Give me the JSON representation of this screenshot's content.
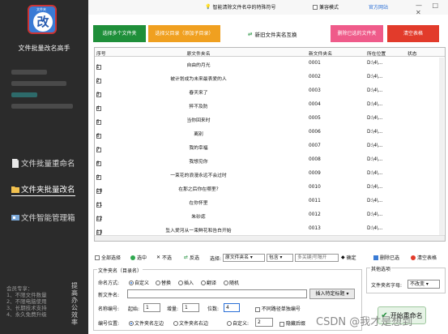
{
  "sidebar": {
    "logo_tag": "文件夹",
    "logo_char": "改",
    "app_title": "文件批量改名高手",
    "nav": [
      {
        "label": "文件批量重命名",
        "icon": "file-icon"
      },
      {
        "label": "文件夹批量改名",
        "icon": "folder-icon",
        "active": true
      },
      {
        "label": "文件智能管理箱",
        "icon": "grid-icon"
      }
    ],
    "promo_lines": [
      "会员专享：",
      "1、不限文件数量",
      "2、不限电脑使用",
      "3、长期技术支持",
      "4、永久免费升级"
    ],
    "promo_side": "提高办公效率"
  },
  "topbar": {
    "option1": "智能清除文件名中的特殊符号",
    "option2": "兼容模式",
    "official_site": "官方网站",
    "window_controls": "— □ ✕"
  },
  "toolbar": {
    "btn_add_files": "选择多个文件夹",
    "btn_add_dir": "选择父目录（添加子目录）",
    "link_swap": "新旧文件夹名互换",
    "btn_delete_selected": "删除已选的文件夹",
    "btn_clear": "清空表格"
  },
  "table": {
    "headers": {
      "no": "序号",
      "name": "原文件夹名",
      "new": "新文件夹名",
      "loc": "所在位置",
      "state": "状态"
    },
    "rows": [
      {
        "no": "1",
        "name": "自由的月光",
        "new": "0001",
        "loc": "D:\\4\\..."
      },
      {
        "no": "2",
        "name": "被计划成为未来最表爱的人",
        "new": "0002",
        "loc": "D:\\4\\..."
      },
      {
        "no": "3",
        "name": "春天来了",
        "new": "0003",
        "loc": "D:\\4\\..."
      },
      {
        "no": "4",
        "name": "猝不及防",
        "new": "0004",
        "loc": "D:\\4\\..."
      },
      {
        "no": "5",
        "name": "当你回来时",
        "new": "0005",
        "loc": "D:\\4\\..."
      },
      {
        "no": "6",
        "name": "离别",
        "new": "0006",
        "loc": "D:\\4\\..."
      },
      {
        "no": "7",
        "name": "我的幸福",
        "new": "0007",
        "loc": "D:\\4\\..."
      },
      {
        "no": "8",
        "name": "我想见你",
        "new": "0008",
        "loc": "D:\\4\\..."
      },
      {
        "no": "9",
        "name": "一束花的浪漫永远不会过时",
        "new": "0009",
        "loc": "D:\\4\\..."
      },
      {
        "no": "10",
        "name": "在那之后你在哪里?",
        "new": "0010",
        "loc": "D:\\4\\..."
      },
      {
        "no": "11",
        "name": "在你怀里",
        "new": "0011",
        "loc": "D:\\4\\..."
      },
      {
        "no": "12",
        "name": "朱砂痣",
        "new": "0012",
        "loc": "D:\\4\\..."
      },
      {
        "no": "13",
        "name": "坠入爱河从一束鲜花和告白开始",
        "new": "0013",
        "loc": "D:\\4\\..."
      }
    ]
  },
  "selbar": {
    "select_all": "全部选择",
    "select": "选中",
    "unselect": "不选",
    "invert": "反选",
    "choose_label": "选择:",
    "field_value": "原文件夹名",
    "mode_value": "包含",
    "search_placeholder": "多关键|号隔开",
    "confirm": "确定",
    "delete_selected": "删除已选",
    "clear_table": "清空表格"
  },
  "rename": {
    "group_title": "文件夹名（目录名）",
    "method_label": "命名方式:",
    "methods": [
      "自定义",
      "替换",
      "插入",
      "翻译",
      "随机"
    ],
    "selected_method": "自定义",
    "new_name_label": "新文件名:",
    "new_name_value": "",
    "insert_btn": "插入特定标题",
    "numbering_label": "名称编号:",
    "start_label": "起始:",
    "start_value": "1",
    "step_label": "增量:",
    "step_value": "1",
    "digits_label": "位数:",
    "digits_value": "4",
    "no_path_label": "不同路径单独编号",
    "position_label": "编号位置:",
    "positions": [
      "文件夹名左边",
      "文件夹名右边",
      "自定义:"
    ],
    "selected_position": "文件夹名左边",
    "custom_pos_value": "2",
    "hide_suffix": "隐藏后缀"
  },
  "other": {
    "group_title": "其他选项",
    "case_label": "文件夹名字母:",
    "case_value": "不改变"
  },
  "start_button": "开始重命名",
  "watermark": "CSDN @我才是想到"
}
